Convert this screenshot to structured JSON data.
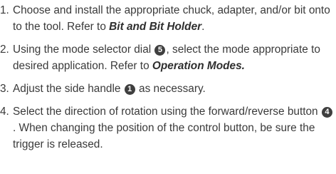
{
  "steps": [
    {
      "num": "1.",
      "text_a": "Choose and install the appropriate chuck, adapter, and/or bit onto to the tool. Refer to ",
      "ref": "Bit and Bit Holder",
      "text_b": "."
    },
    {
      "num": "2.",
      "text_a": "Using the mode selector dial ",
      "badge": "5",
      "text_b": ", select the mode appropriate to desired application. Refer to ",
      "ref": "Operation Modes",
      "text_c": "."
    },
    {
      "num": "3.",
      "text_a": "Adjust the side handle ",
      "badge": "1",
      "text_b": " as necessary."
    },
    {
      "num": "4.",
      "text_a": "Select the direction of rotation using the forward/reverse button ",
      "badge": "4",
      "text_b": ". When changing the position of the control button, be sure the trigger is released."
    }
  ]
}
